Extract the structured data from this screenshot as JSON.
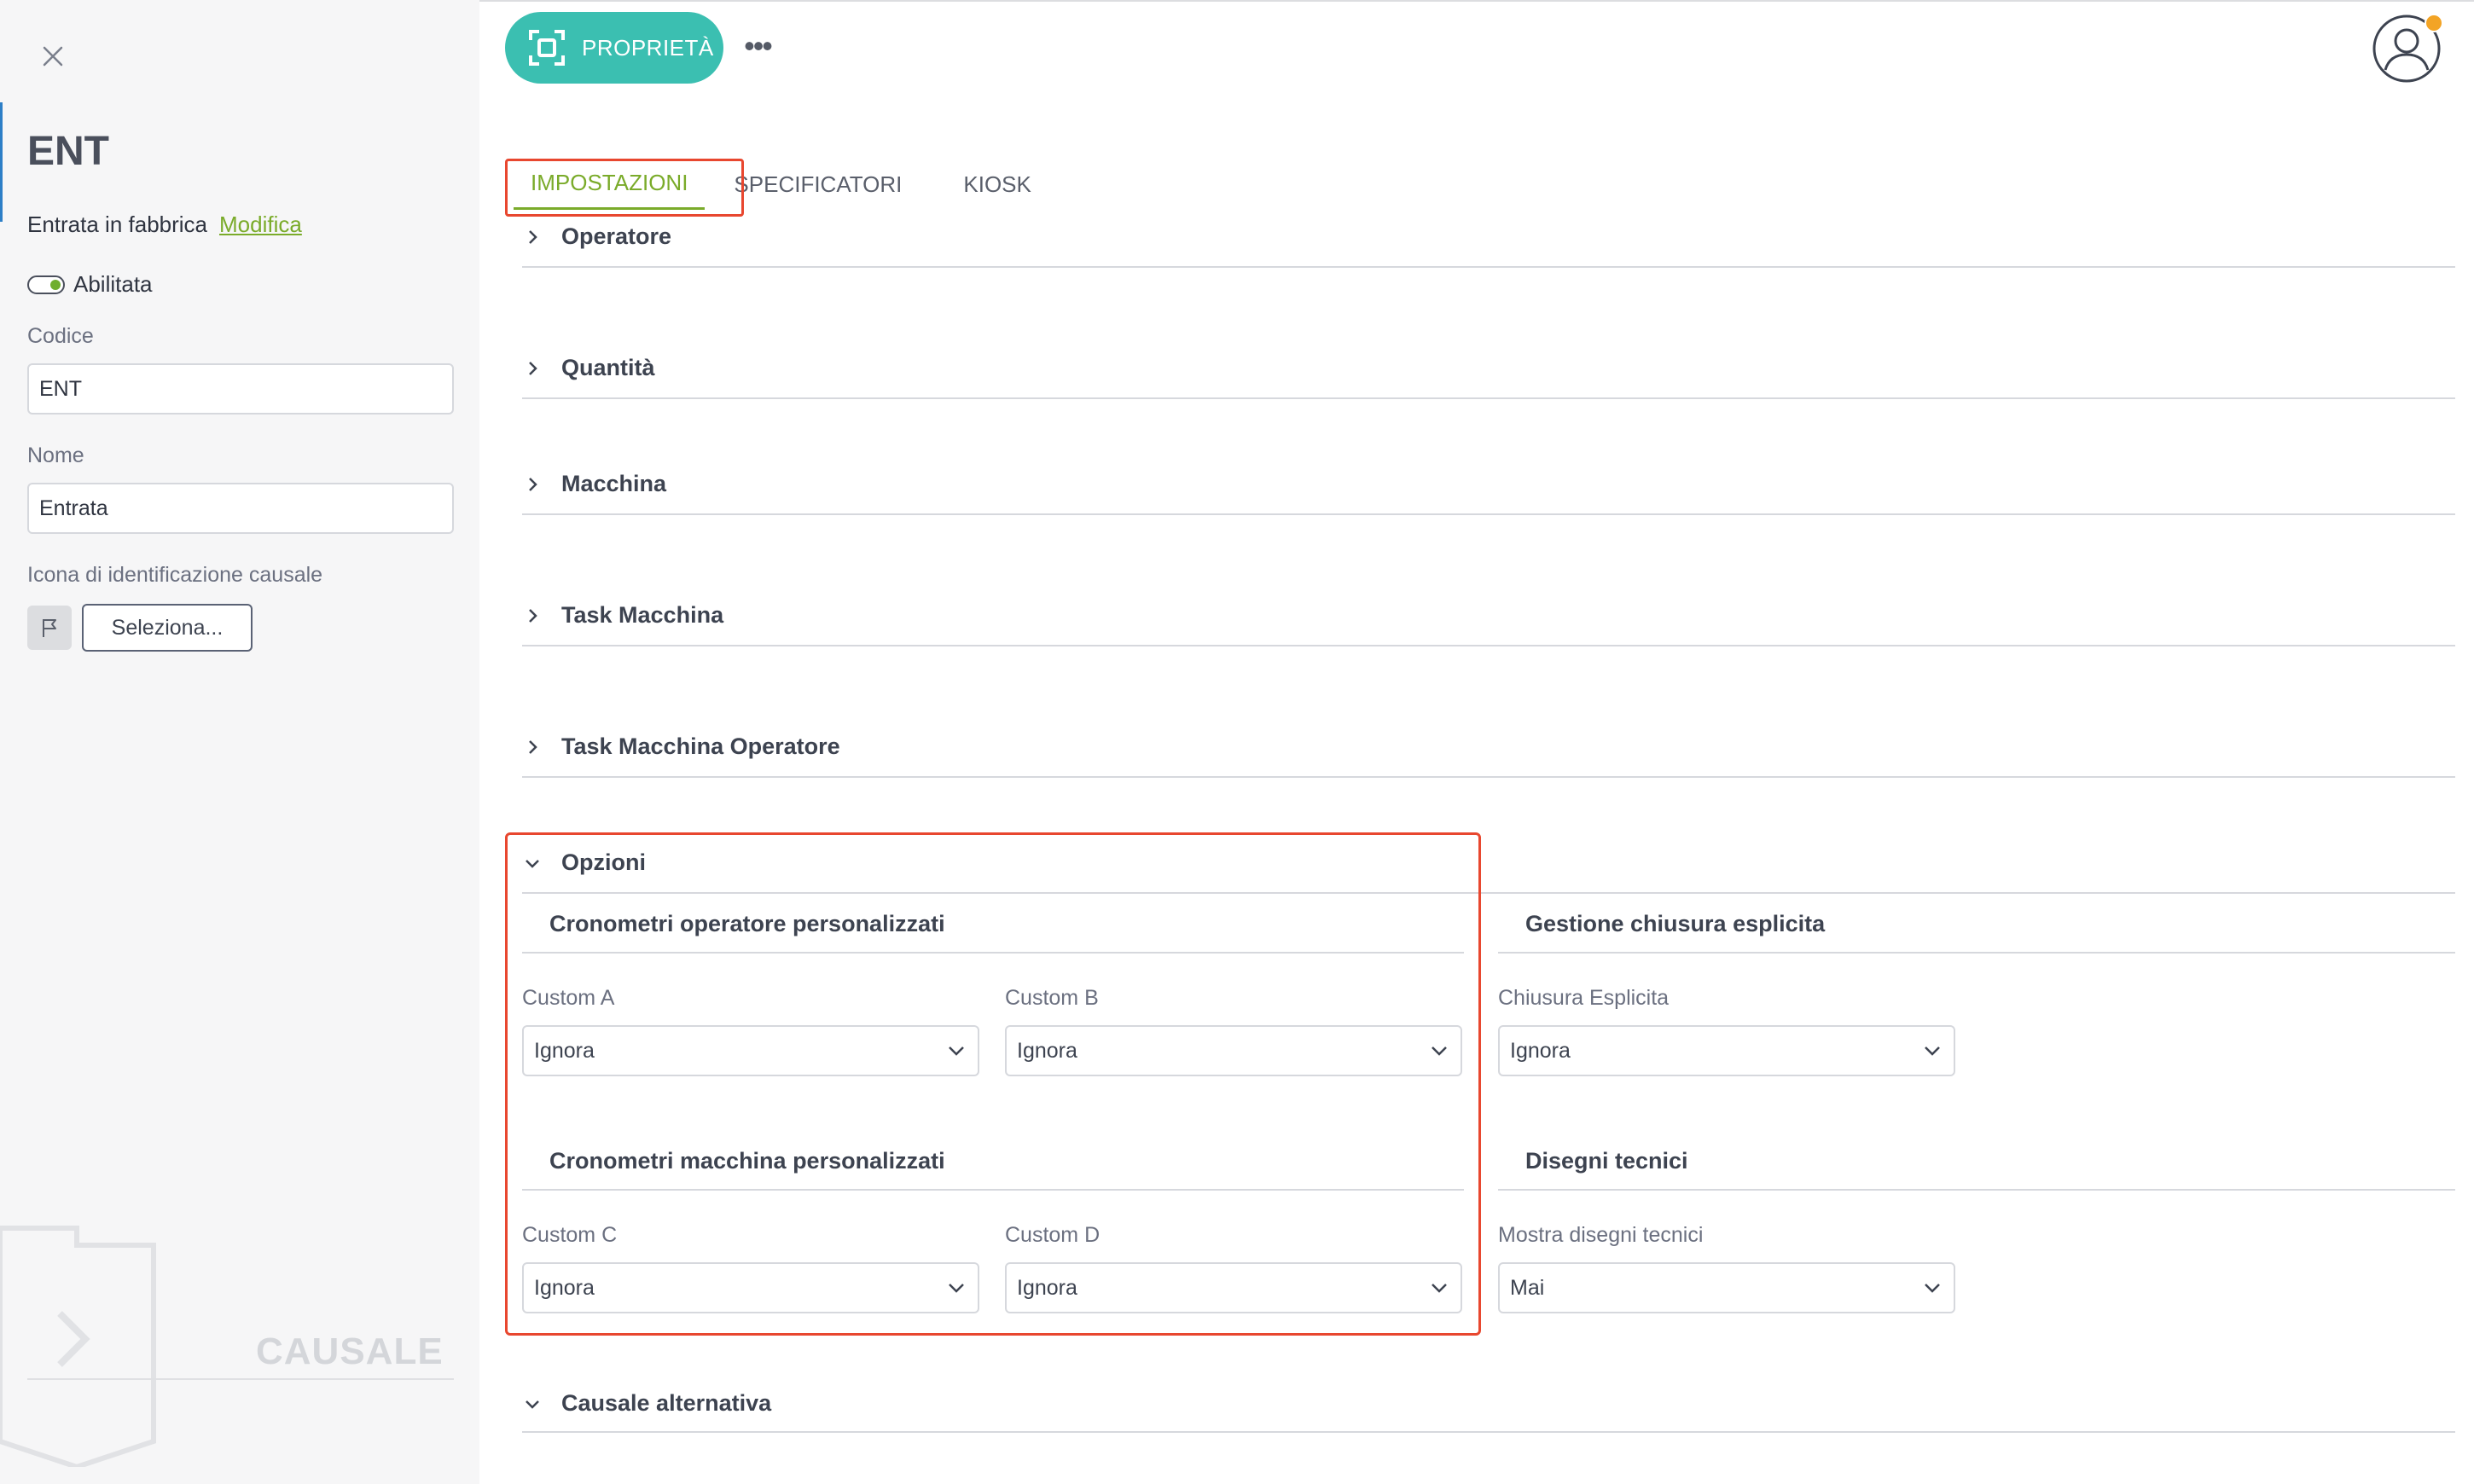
{
  "left_panel": {
    "code": "ENT",
    "type_text": "Entrata in fabbrica",
    "edit_link": "Modifica",
    "toggle_label": "Abilitata",
    "codice_label": "Codice",
    "codice_value": "ENT",
    "nome_label": "Nome",
    "nome_value": "Entrata",
    "icon_label": "Icona di identificazione causale",
    "select_button": "Seleziona...",
    "watermark": "CAUSALE"
  },
  "toolbar": {
    "properties_label": "PROPRIETÀ",
    "more_label": "•••"
  },
  "tabs": [
    "IMPOSTAZIONI",
    "SPECIFICATORI",
    "KIOSK"
  ],
  "sections": {
    "operatore": "Operatore",
    "quantita": "Quantità",
    "macchina": "Macchina",
    "task_macchina": "Task Macchina",
    "task_macchina_operatore": "Task Macchina Operatore",
    "opzioni": "Opzioni",
    "causale_alternativa": "Causale alternativa"
  },
  "opzioni": {
    "cron_operatore_title": "Cronometri operatore personalizzati",
    "custom_a_label": "Custom A",
    "custom_a_value": "Ignora",
    "custom_b_label": "Custom B",
    "custom_b_value": "Ignora",
    "cron_macchina_title": "Cronometri macchina personalizzati",
    "custom_c_label": "Custom C",
    "custom_c_value": "Ignora",
    "custom_d_label": "Custom D",
    "custom_d_value": "Ignora",
    "chiusura_title": "Gestione chiusura esplicita",
    "chiusura_label": "Chiusura Esplicita",
    "chiusura_value": "Ignora",
    "disegni_title": "Disegni tecnici",
    "disegni_label": "Mostra disegni tecnici",
    "disegni_value": "Mai"
  },
  "colors": {
    "accent_green": "#7aab2a",
    "teal_button": "#3bbfb1",
    "highlight_red": "#e8472f",
    "badge_orange": "#f3a425"
  },
  "icons": [
    "close-icon",
    "flag-icon",
    "focus-frame-icon",
    "more-icon",
    "user-avatar-icon",
    "chevron-right-icon",
    "chevron-down-icon"
  ]
}
